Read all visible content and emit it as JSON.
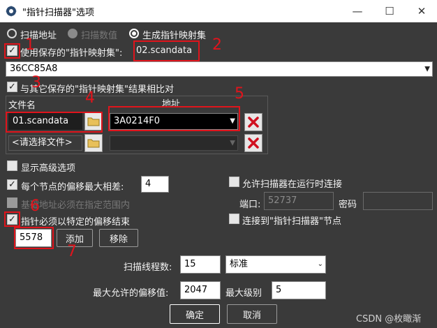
{
  "window": {
    "title": "\"指针扫描器\"选项",
    "controls": {
      "minimize": "—",
      "maximize": "☐",
      "close": "✕"
    }
  },
  "scan_mode": {
    "options": [
      {
        "label": "扫描地址",
        "state": "unselected"
      },
      {
        "label": "扫描数值",
        "state": "disabled"
      },
      {
        "label": "生成指针映射集",
        "state": "selected"
      }
    ]
  },
  "use_saved": {
    "checkbox_label": "使用保存的\"指针映射集\":",
    "checked": true,
    "filename": "02.scandata",
    "address_value": "36CC85A8"
  },
  "compare": {
    "checkbox_label": "与其它保存的\"指针映射集\"结果相比对",
    "checked": true,
    "col_filename": "文件名",
    "col_address": "地址",
    "rows": [
      {
        "filename": "01.scandata",
        "address": "3A0214F0",
        "enabled": true
      },
      {
        "filename": "<请选择文件>",
        "address": "",
        "enabled": false
      }
    ]
  },
  "advanced": {
    "show_advanced_label": "显示高级选项",
    "show_advanced_checked": false,
    "max_offset_diff_label": "每个节点的偏移最大相差:",
    "max_offset_diff_checked": true,
    "max_offset_diff_value": "4",
    "base_range_label": "基础地址必须在指定范围内",
    "base_range_checked": false,
    "must_end_label": "指针必须以特定的偏移结束",
    "must_end_checked": true,
    "offset_value": "5578",
    "add_label": "添加",
    "remove_label": "移除"
  },
  "network": {
    "allow_connect_label": "允许扫描器在运行时连接",
    "allow_connect_checked": false,
    "port_label": "端口:",
    "port_value": "52737",
    "password_label": "密码",
    "password_value": "",
    "connect_node_label": "连接到\"指针扫描器\"节点",
    "connect_node_checked": false
  },
  "threads": {
    "label": "扫描线程数:",
    "value": "15",
    "priority": "标准"
  },
  "limits": {
    "max_offset_label": "最大允许的偏移值:",
    "max_offset_value": "2047",
    "max_level_label": "最大级别",
    "max_level_value": "5"
  },
  "footer": {
    "ok_label": "确定",
    "cancel_label": "取消",
    "watermark": "CSDN @枚瞰渐"
  },
  "annotations": [
    "1",
    "2",
    "3",
    "4",
    "5",
    "6",
    "7"
  ],
  "colors": {
    "annotation_red": "#e0141c",
    "dialog_bg": "#3a3a3a",
    "delete_red": "#d01020"
  }
}
